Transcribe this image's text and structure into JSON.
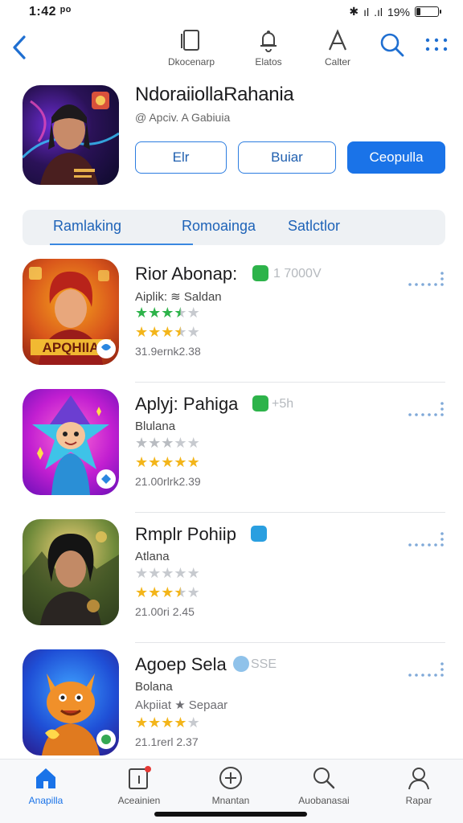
{
  "status": {
    "time": "1:42 ᵖᵒ",
    "battery": "19%",
    "battery_level": 0.19
  },
  "nav": {
    "back": "back",
    "items": [
      {
        "label": "Dkocenarp",
        "icon": "device-icon"
      },
      {
        "label": "Elatos",
        "icon": "bell-icon"
      },
      {
        "label": "Calter",
        "icon": "triangle-a-icon"
      }
    ]
  },
  "hero": {
    "title": "NdoraiiollaRahania",
    "subtitle": "@ Apciv. A Gabiuia",
    "buttons": {
      "first": "Elr",
      "second": "Buiar",
      "primary": "Ceopulla"
    }
  },
  "tabs": [
    "Ramlaking",
    "Romoainga",
    "Satlctlor"
  ],
  "apps": [
    {
      "name": "Rior Abonap:",
      "badge_color": "#2db34a",
      "extra": "1 7000V",
      "developer": "Aiplik: ≋ Saldan",
      "rating_1": 3.5,
      "rating_2": 3.5,
      "meta": "31.9ernk2.38",
      "stars_colors": [
        "#2db34a",
        "#f3b51a"
      ]
    },
    {
      "name": "Aplyj: Pahiga",
      "badge_color": "#2db34a",
      "extra": "+5h",
      "developer": "Blulana",
      "rating_1": 3.0,
      "rating_2": 5.0,
      "meta": "21.00rlrk2.39",
      "stars_colors": [
        "#b9bcc1",
        "#f3b51a"
      ]
    },
    {
      "name": "Rmplr Pohiip",
      "badge_color": "#2a9fe0",
      "extra": "",
      "developer": "Atlana",
      "rating_1": 0,
      "rating_2": 3.5,
      "meta": "21.00ri 2.45",
      "stars_colors": [
        "#b9bcc1",
        "#f3b51a"
      ]
    },
    {
      "name": "Agoep Sela",
      "badge_color": "#8fc2ea",
      "extra": "SSE",
      "developer": "Bolana",
      "developer_line2": "Akpiiat ★ Sepaar",
      "rating_1": 4.0,
      "meta": "21.1rerl 2.37",
      "stars_colors": [
        "#f3b51a"
      ]
    }
  ],
  "bottom_nav": [
    {
      "label": "Anapilla",
      "icon": "home-icon",
      "active": true
    },
    {
      "label": "Aceainien",
      "icon": "updates-icon",
      "active": false
    },
    {
      "label": "Mnantan",
      "icon": "add-circle-icon",
      "active": false
    },
    {
      "label": "Auobanasai",
      "icon": "search-icon",
      "active": false
    },
    {
      "label": "Rapar",
      "icon": "profile-icon",
      "active": false
    }
  ]
}
